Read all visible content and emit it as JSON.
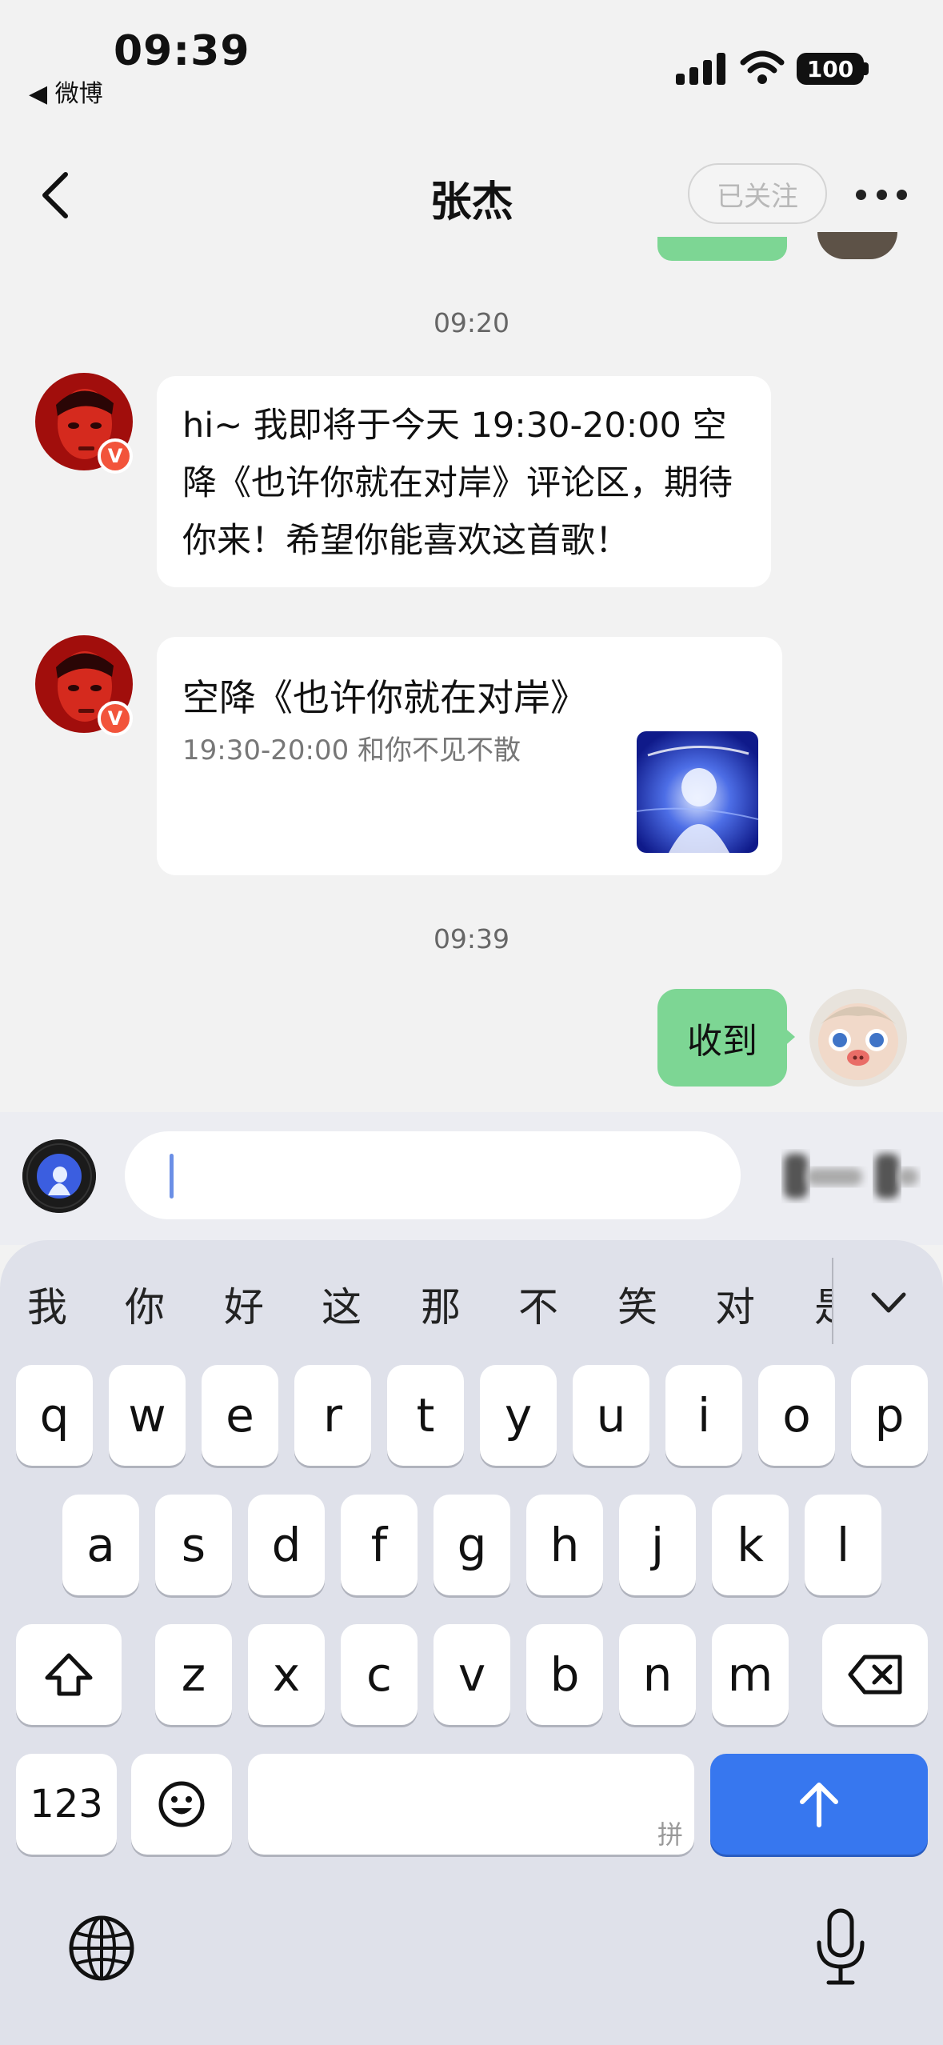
{
  "status_bar": {
    "time": "09:39",
    "back_app": "◀ 微博",
    "battery": "100"
  },
  "nav": {
    "title": "张杰",
    "follow_label": "已关注",
    "back_icon": "chevron-left-icon",
    "more_icon": "more-dots-icon"
  },
  "messages": {
    "ts1": "09:20",
    "msg1": "hi~ 我即将于今天 19:30-20:00 空降《也许你就在对岸》评论区，期待你来！希望你能喜欢这首歌！",
    "badge": "V",
    "card": {
      "title": "空降《也许你就在对岸》",
      "subtitle": "19:30-20:00 和你不见不散"
    },
    "ts2": "09:39",
    "my_msg": "收到"
  },
  "composer": {
    "value": "",
    "placeholder": ""
  },
  "keyboard": {
    "candidates": [
      "我",
      "你",
      "好",
      "这",
      "那",
      "不",
      "笑",
      "对",
      "是"
    ],
    "row1": [
      "q",
      "w",
      "e",
      "r",
      "t",
      "y",
      "u",
      "i",
      "o",
      "p"
    ],
    "row2": [
      "a",
      "s",
      "d",
      "f",
      "g",
      "h",
      "j",
      "k",
      "l"
    ],
    "row3": [
      "z",
      "x",
      "c",
      "v",
      "b",
      "n",
      "m"
    ],
    "num_key": "123",
    "space_hint": "拼"
  },
  "colors": {
    "my_bubble": "#7dd694",
    "send_key": "#3777ef",
    "v_badge": "#f2543b"
  }
}
